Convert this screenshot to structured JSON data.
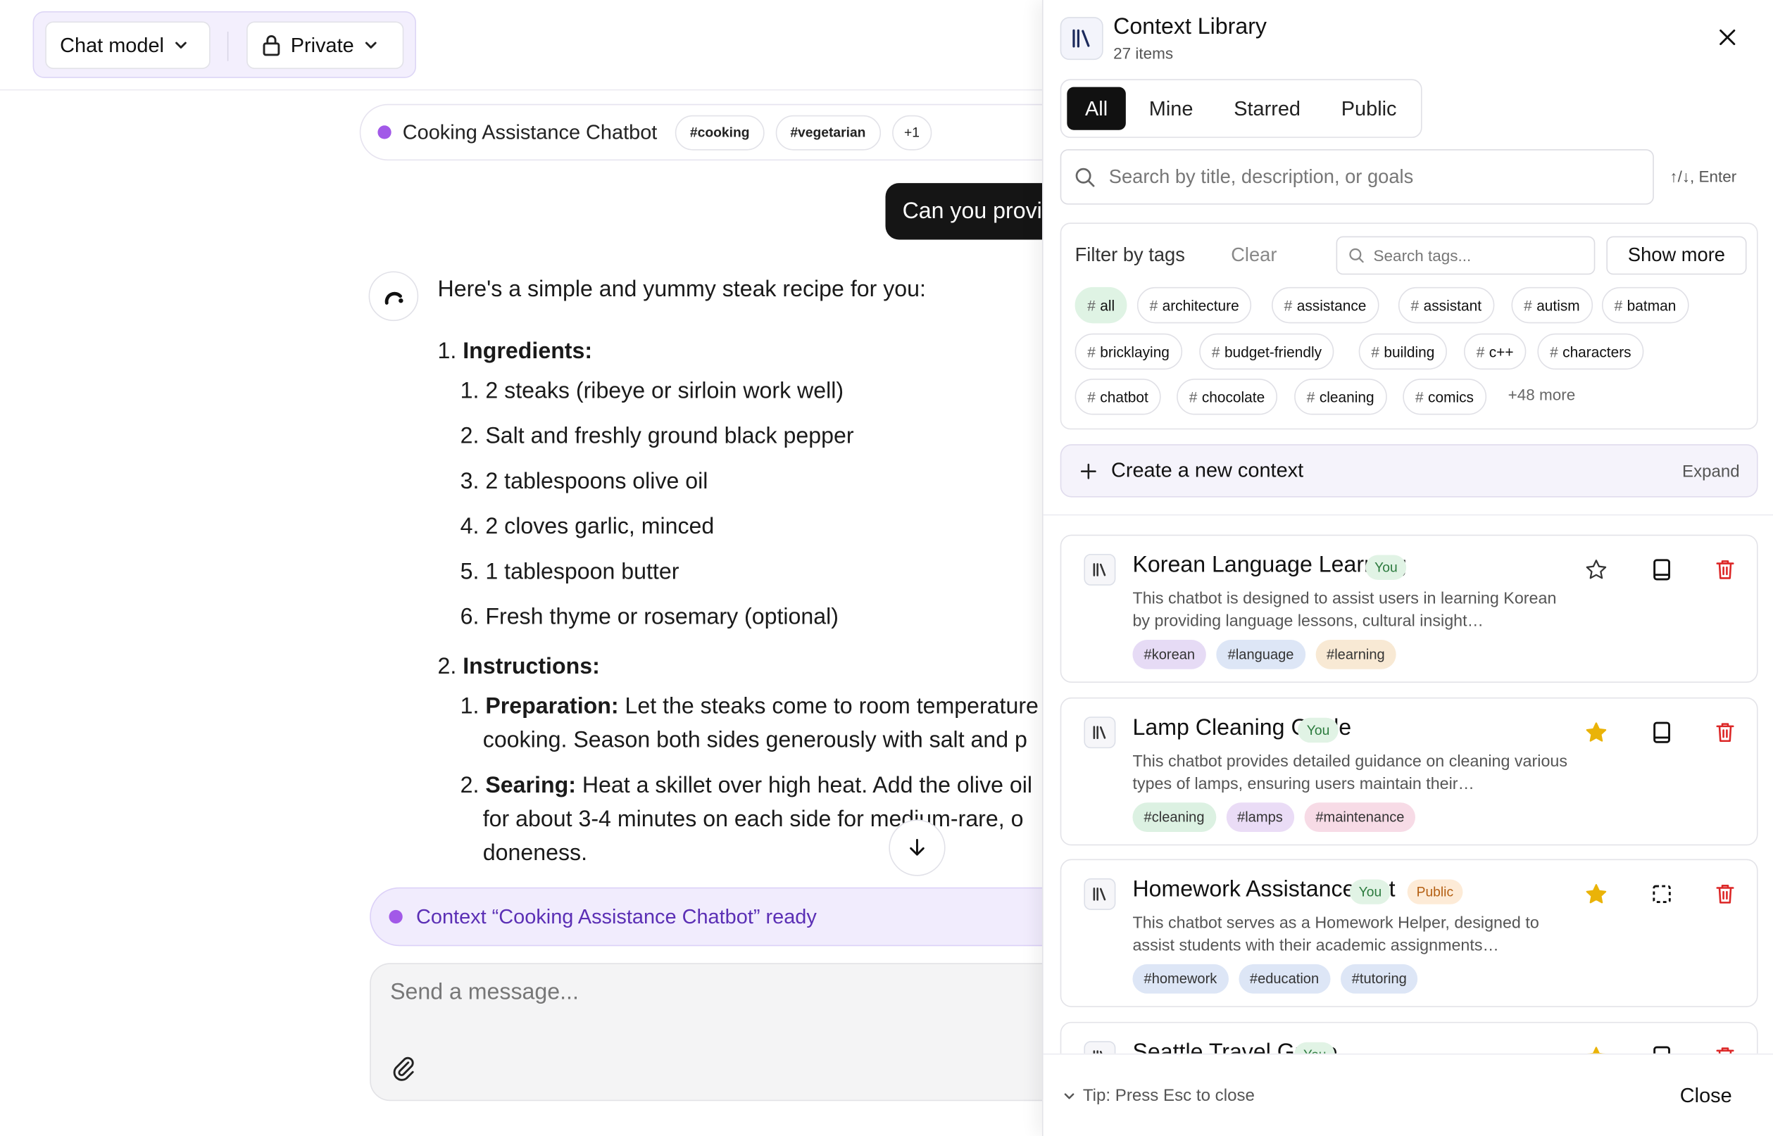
{
  "topbar": {
    "model_label": "Chat model",
    "visibility_label": "Private"
  },
  "context_pill": {
    "title": "Cooking Assistance Chatbot",
    "tags": [
      "#cooking",
      "#vegetarian"
    ],
    "more": "+1"
  },
  "user_message": "Can you provi",
  "answer": {
    "intro": "Here's a simple and yummy steak recipe for you:",
    "section1_num": "1.",
    "section1_title": "Ingredients:",
    "ingredients": [
      {
        "num": "1.",
        "text": "2 steaks (ribeye or sirloin work well)"
      },
      {
        "num": "2.",
        "text": "Salt and freshly ground black pepper"
      },
      {
        "num": "3.",
        "text": "2 tablespoons olive oil"
      },
      {
        "num": "4.",
        "text": "2 cloves garlic, minced"
      },
      {
        "num": "5.",
        "text": "1 tablespoon butter"
      },
      {
        "num": "6.",
        "text": "Fresh thyme or rosemary (optional)"
      }
    ],
    "section2_num": "2.",
    "section2_title": "Instructions:",
    "steps": [
      {
        "num": "1.",
        "title": "Preparation:",
        "line1": " Let the steaks come to room temperature",
        "line2": "cooking. Season both sides generously with salt and p"
      },
      {
        "num": "2.",
        "title": "Searing:",
        "line1": " Heat a skillet over high heat. Add the olive oil",
        "line2": "for about 3-4 minutes on each side for medium-rare, o",
        "line3": "doneness."
      }
    ]
  },
  "ready_bar": "Context “Cooking Assistance Chatbot” ready",
  "composer": {
    "placeholder": "Send a message..."
  },
  "panel": {
    "title": "Context Library",
    "count": "27 items",
    "tabs": [
      "All",
      "Mine",
      "Starred",
      "Public"
    ],
    "active_tab": "All",
    "search_placeholder": "Search by title, description, or goals",
    "search_hint": "↑/↓, Enter",
    "filter": {
      "label": "Filter by tags",
      "clear": "Clear",
      "tag_search_placeholder": "Search tags...",
      "show_more": "Show more",
      "tags": [
        "all",
        "architecture",
        "assistance",
        "assistant",
        "autism",
        "batman",
        "bricklaying",
        "budget-friendly",
        "building",
        "c++",
        "characters",
        "chatbot",
        "chocolate",
        "cleaning",
        "comics"
      ],
      "more": "+48 more"
    },
    "create": {
      "label": "Create a new context",
      "expand": "Expand"
    },
    "cards": [
      {
        "title": "Korean Language Learning",
        "badges": [
          "You"
        ],
        "desc": "This chatbot is designed to assist users in learning Korean by providing language lessons, cultural insight…",
        "tags": [
          "#korean",
          "#language",
          "#learning"
        ],
        "tag_colors": [
          "#e6dbf5",
          "#dde6f6",
          "#f8e9d4"
        ],
        "starred": false
      },
      {
        "title": "Lamp Cleaning Guide",
        "badges": [
          "You"
        ],
        "desc": "This chatbot provides detailed guidance on cleaning various types of lamps, ensuring users maintain their…",
        "tags": [
          "#cleaning",
          "#lamps",
          "#maintenance"
        ],
        "tag_colors": [
          "#dcf1e2",
          "#eadcf6",
          "#f7dbe6"
        ],
        "starred": true
      },
      {
        "title": "Homework Assistance Bot",
        "badges": [
          "You",
          "Public"
        ],
        "desc": "This chatbot serves as a Homework Helper, designed to assist students with their academic assignments…",
        "tags": [
          "#homework",
          "#education",
          "#tutoring"
        ],
        "tag_colors": [
          "#dde6f6",
          "#dde6f6",
          "#dde6f6"
        ],
        "starred": true
      },
      {
        "title": "Seattle Travel Guide",
        "badges": [
          "You"
        ],
        "desc": "",
        "tags": [],
        "tag_colors": [],
        "starred": true
      }
    ],
    "footer": {
      "tip": "Tip: Press Esc to close",
      "close": "Close"
    }
  },
  "colors": {
    "accent": "#a259e8",
    "star": "#eab308",
    "delete": "#dc2626",
    "active_tab": "#111111"
  }
}
